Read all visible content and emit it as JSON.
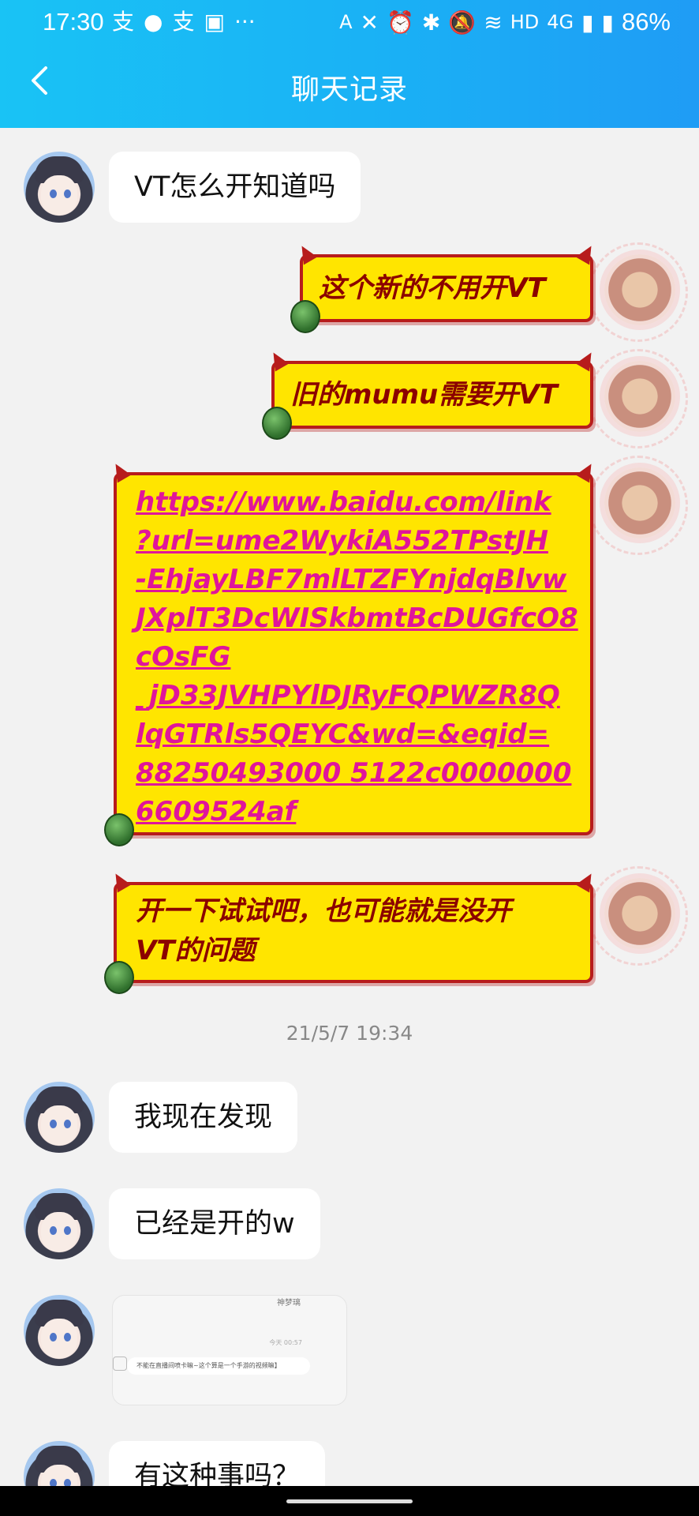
{
  "status_bar": {
    "time": "17:30",
    "left_icons": [
      "alipay-icon",
      "message-icon",
      "alipay-icon",
      "gallery-icon",
      "more-icon"
    ],
    "more": "···",
    "network": "HD",
    "signal": "4G",
    "battery": "86%"
  },
  "header": {
    "title": "聊天记录",
    "back_icon": "chevron-left-icon",
    "background": "#1ab6f5"
  },
  "messages": [
    {
      "side": "left",
      "type": "text",
      "text": "VT怎么开知道吗"
    },
    {
      "side": "right",
      "type": "text",
      "text": "这个新的不用开VT"
    },
    {
      "side": "right",
      "type": "text",
      "text": "旧的mumu需要开VT"
    },
    {
      "side": "right",
      "type": "link",
      "text": "https://www.baidu.com/link?url=ume2WykiA552TPstJH-EhjayLBF7mlLTZFYnjdqBlvwJXplT3DcWISkbmtBcDUGfcO8cOsFG_jD33JVHPYlDJRyFQPWZR8QlqGTRls5QEYC&wd=&eqid=88250493000 5122c0000000 6609524af"
    },
    {
      "side": "right",
      "type": "text",
      "text": "开一下试试吧，也可能就是没开VT的问题"
    },
    {
      "side": "center",
      "type": "timestamp",
      "text": "21/5/7 19:34"
    },
    {
      "side": "left",
      "type": "text",
      "text": "我现在发现"
    },
    {
      "side": "left",
      "type": "text",
      "text": "已经是开的w"
    },
    {
      "side": "left",
      "type": "image",
      "image_text": {
        "name": "神梦璃",
        "time": "今天 00:57",
        "quote": "不能在直播间喷卡嘛~这个算是一个手游的视频嘛】"
      }
    },
    {
      "side": "left",
      "type": "text",
      "text": "有这种事吗？"
    }
  ],
  "link_lines": [
    "https://www.baidu.com/link",
    "?url=ume2WykiA552TPstJH",
    "-EhjayLBF7mlLTZFYnjdqBlvw",
    "JXplT3DcWISkbmtBcDUGfcO8",
    "cOsFG",
    "_jD33JVHPYlDJRyFQPWZR8Q",
    "lqGTRls5QEYC&wd=&eqid=",
    "88250493000 5122c0000000",
    "6609524af"
  ],
  "bubble_five_lines": [
    "开一下试试吧，也可能就是没开",
    "VT的问题"
  ],
  "colors": {
    "yellow_bubble": "#ffe500",
    "bubble_border": "#b71c1c",
    "link": "#e0159b",
    "chat_bg": "#f2f2f2"
  }
}
